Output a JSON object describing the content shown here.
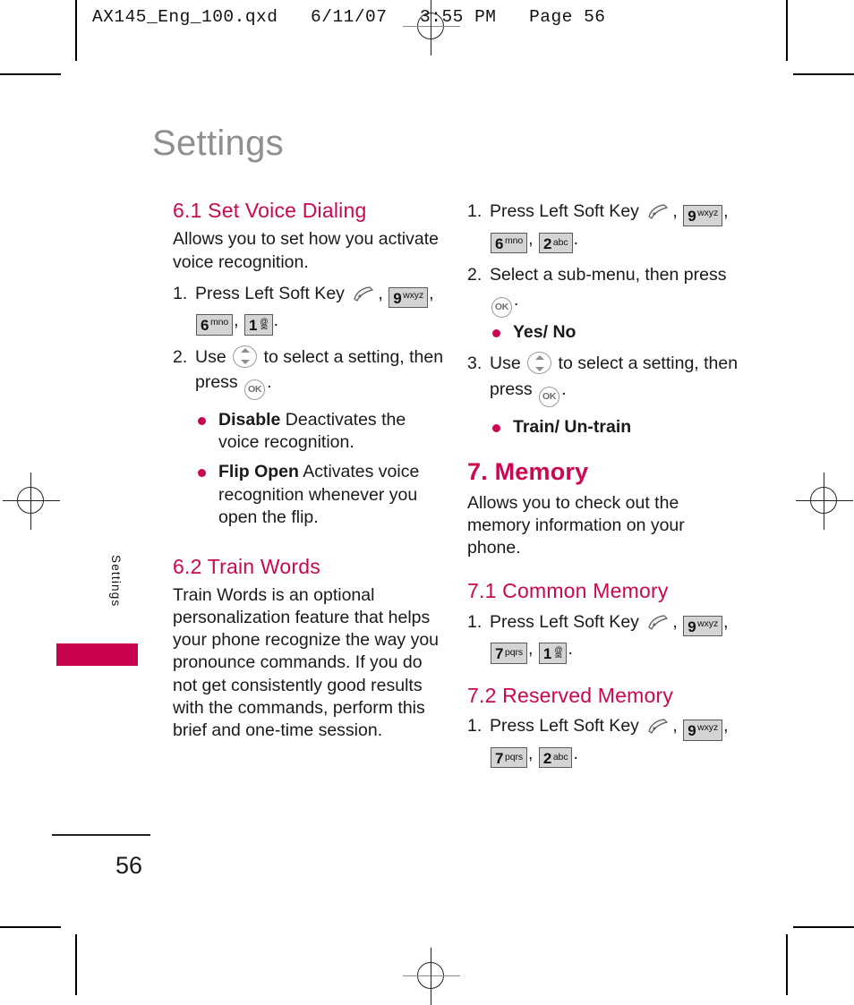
{
  "print_header": "AX145_Eng_100.qxd   6/11/07   3:55 PM   Page 56",
  "page_title": "Settings",
  "side_tab_label": "Settings",
  "page_number": "56",
  "colors": {
    "accent_pink": "#CC0651",
    "tab_pink": "#C9034F",
    "title_gray": "#8f8f8f",
    "key_fill": "#d4d4d4"
  },
  "icons": {
    "left_soft_key": "left-soft-key-icon",
    "ok_key": "OK",
    "nav_updown": "nav-up-down-icon",
    "envelope": "✉",
    "at_sign": "@"
  },
  "left_column": {
    "section_61": {
      "heading": "6.1 Set Voice Dialing",
      "intro": "Allows you to set how you activate voice recognition.",
      "steps": [
        {
          "num": "1.",
          "lead": "Press Left Soft Key",
          "keys": [
            {
              "digit": "9",
              "letters": "wxyz",
              "sup": true
            },
            {
              "digit": "6",
              "letters": "mno",
              "sup": true
            },
            {
              "digit": "1",
              "letters": "",
              "icon": "envelope-at"
            }
          ]
        },
        {
          "num": "2.",
          "text_a": "Use",
          "text_b": "to select a setting, then press",
          "ok": "OK"
        }
      ],
      "bullets": [
        {
          "term": "Disable",
          "desc": "Deactivates the voice recognition."
        },
        {
          "term": "Flip Open",
          "desc": "Activates voice recognition whenever you open the flip."
        }
      ]
    },
    "section_62": {
      "heading": "6.2 Train Words",
      "body": "Train Words is an optional personalization feature that helps your phone recognize the way you pronounce commands. If you do not get consistently good results with the commands, perform this brief and one-time session."
    }
  },
  "right_column": {
    "section_62_cont": {
      "steps": [
        {
          "num": "1.",
          "lead": "Press Left Soft Key",
          "keys": [
            {
              "digit": "9",
              "letters": "wxyz",
              "sup": true
            },
            {
              "digit": "6",
              "letters": "mno",
              "sup": true
            },
            {
              "digit": "2",
              "letters": "abc",
              "sup": false
            }
          ]
        },
        {
          "num": "2.",
          "text": "Select a sub-menu, then press",
          "ok": "OK"
        },
        {
          "num": "3.",
          "text_a": "Use",
          "text_b": "to select a setting, then press",
          "ok": "OK"
        }
      ],
      "bullets": [
        {
          "label": "Yes/ No"
        },
        {
          "label": "Train/ Un-train"
        }
      ]
    },
    "section_7": {
      "heading": "7. Memory",
      "intro": "Allows you to check out the memory information on your phone."
    },
    "section_71": {
      "heading": "7.1 Common Memory",
      "step": {
        "num": "1.",
        "lead": "Press Left Soft Key",
        "keys": [
          {
            "digit": "9",
            "letters": "wxyz",
            "sup": true
          },
          {
            "digit": "7",
            "letters": "pqrs",
            "sup": false
          },
          {
            "digit": "1",
            "letters": "",
            "icon": "envelope-at"
          }
        ]
      }
    },
    "section_72": {
      "heading": "7.2 Reserved Memory",
      "step": {
        "num": "1.",
        "lead": "Press Left Soft Key",
        "keys": [
          {
            "digit": "9",
            "letters": "wxyz",
            "sup": true
          },
          {
            "digit": "7",
            "letters": "pqrs",
            "sup": false
          },
          {
            "digit": "2",
            "letters": "abc",
            "sup": false
          }
        ]
      }
    }
  }
}
